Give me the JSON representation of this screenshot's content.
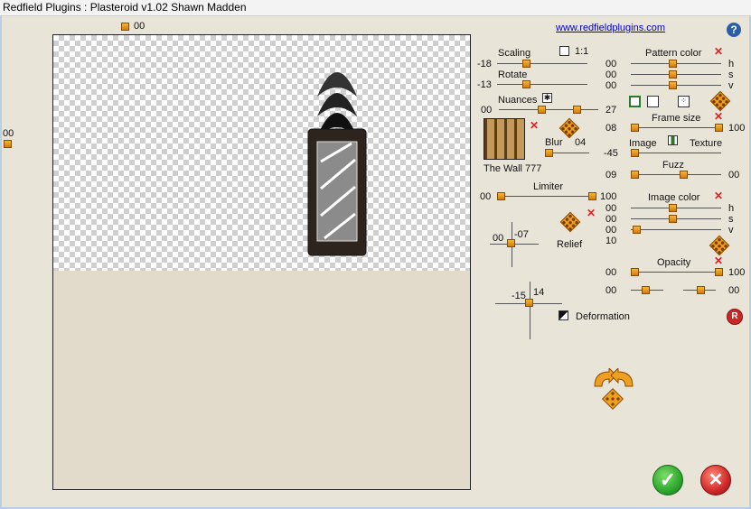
{
  "window": {
    "title": "Redfield Plugins : Plasteroid v1.02   Shawn Madden"
  },
  "link": "www.redfieldplugins.com",
  "preview": {
    "top_value": "00",
    "left_value": "00"
  },
  "scaling": {
    "label": "Scaling",
    "value": "-18",
    "check_label": "1:1"
  },
  "rotate": {
    "label": "Rotate",
    "value": "-13"
  },
  "nuances": {
    "label": "Nuances",
    "min": "00",
    "max": "27"
  },
  "texture": {
    "name": "The Wall 777",
    "blur_label": "Blur",
    "blur_value": "04"
  },
  "limiter": {
    "label": "Limiter",
    "min": "00",
    "max": "100"
  },
  "relief": {
    "label": "Relief",
    "x": "00",
    "y": "-07"
  },
  "deformation": {
    "label": "Deformation",
    "x": "-15",
    "y": "14"
  },
  "pattern_color": {
    "label": "Pattern color",
    "h": "00",
    "s": "00",
    "v": "00",
    "h_label": "h",
    "s_label": "s",
    "v_label": "v"
  },
  "frame_size": {
    "label": "Frame size",
    "min": "08",
    "max": "100"
  },
  "image_texture": {
    "image_label": "Image",
    "texture_label": "Texture",
    "value": "-45"
  },
  "fuzz": {
    "label": "Fuzz",
    "min": "09",
    "max": "00"
  },
  "image_color": {
    "label": "Image color",
    "h": "00",
    "s": "00",
    "v": "00",
    "extra": "10",
    "h_label": "h",
    "s_label": "s",
    "v_label": "v"
  },
  "opacity": {
    "label": "Opacity",
    "min": "00",
    "max": "100",
    "a": "00",
    "b": "00"
  },
  "colors": {
    "accent": "#f0a020",
    "ok": "#2ea82e",
    "cancel": "#d02828",
    "link": "#0000cc"
  }
}
